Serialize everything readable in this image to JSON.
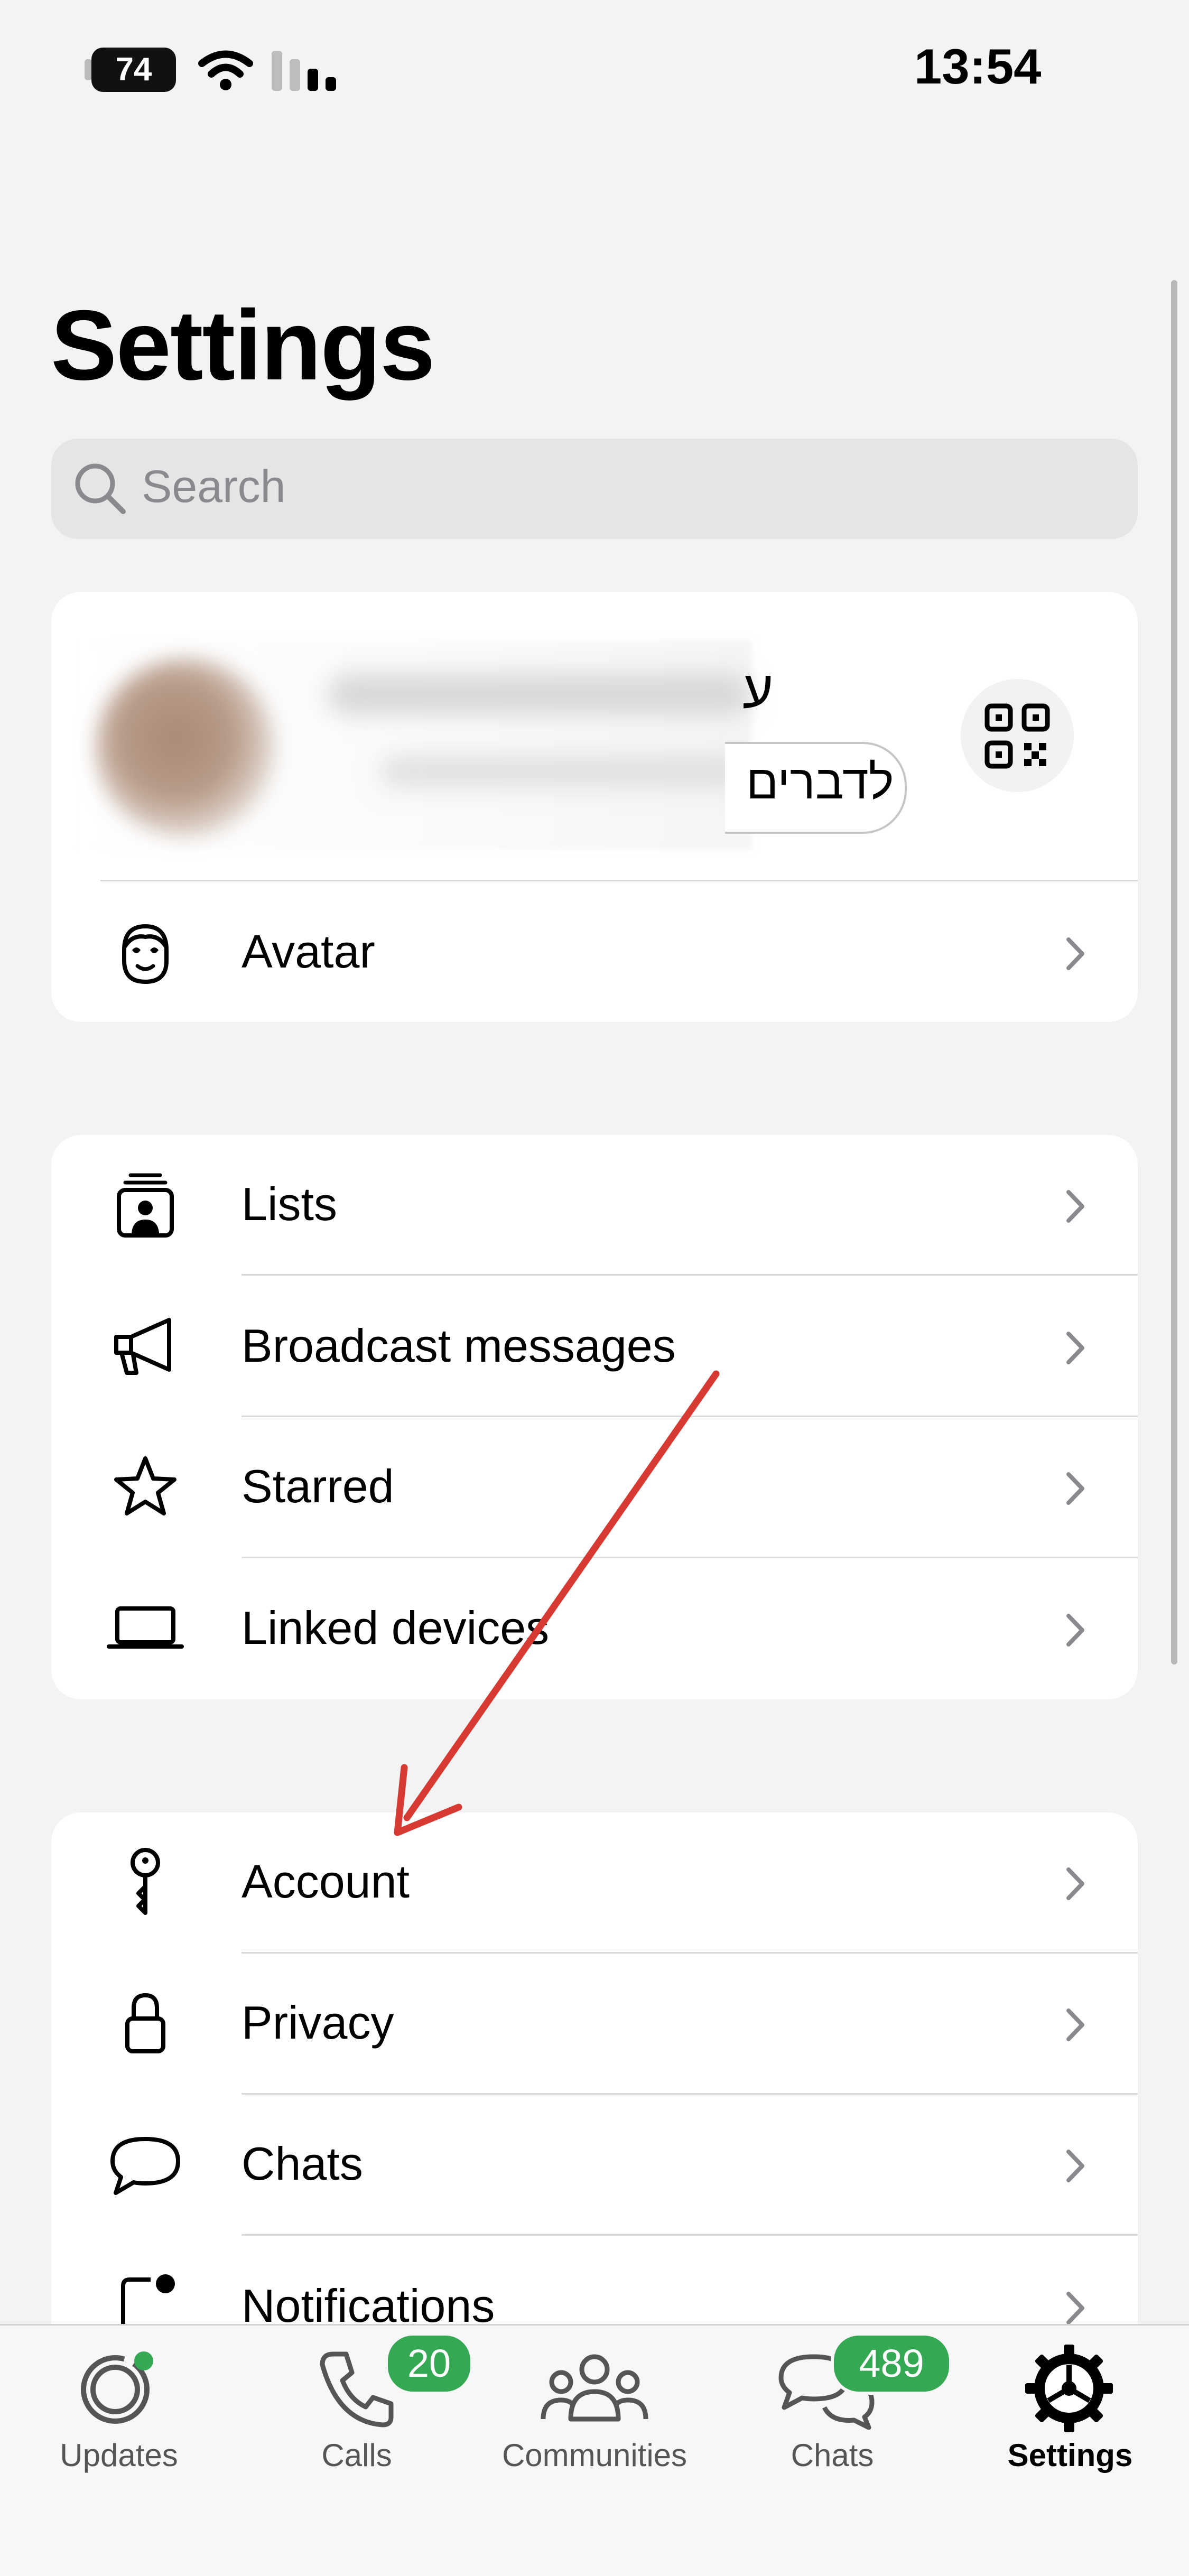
{
  "status_bar": {
    "battery": "74",
    "time": "13:54"
  },
  "page": {
    "title": "Settings"
  },
  "search": {
    "placeholder": "Search"
  },
  "profile": {
    "name_visible_part": "ע",
    "status_visible_part": "לדברים"
  },
  "avatar_row": {
    "label": "Avatar"
  },
  "group1": {
    "items": [
      {
        "label": "Lists",
        "icon": "lists-icon"
      },
      {
        "label": "Broadcast messages",
        "icon": "megaphone-icon"
      },
      {
        "label": "Starred",
        "icon": "star-icon"
      },
      {
        "label": "Linked devices",
        "icon": "laptop-icon"
      }
    ]
  },
  "group2": {
    "items": [
      {
        "label": "Account",
        "icon": "key-icon"
      },
      {
        "label": "Privacy",
        "icon": "lock-icon"
      },
      {
        "label": "Chats",
        "icon": "chat-bubble-icon"
      },
      {
        "label": "Notifications",
        "icon": "notification-icon"
      }
    ]
  },
  "annotation": {
    "color": "#d63a32",
    "shape": "arrow pointing to Account"
  },
  "tabbar": {
    "tabs": [
      {
        "label": "Updates",
        "icon": "updates-icon"
      },
      {
        "label": "Calls",
        "icon": "phone-icon",
        "badge": "20"
      },
      {
        "label": "Communities",
        "icon": "communities-icon"
      },
      {
        "label": "Chats",
        "icon": "chats-icon",
        "badge": "489"
      },
      {
        "label": "Settings",
        "icon": "settings-gear-icon",
        "active": true
      }
    ]
  },
  "colors": {
    "badge": "#34a853",
    "background": "#f3f3f3",
    "card": "#ffffff"
  }
}
